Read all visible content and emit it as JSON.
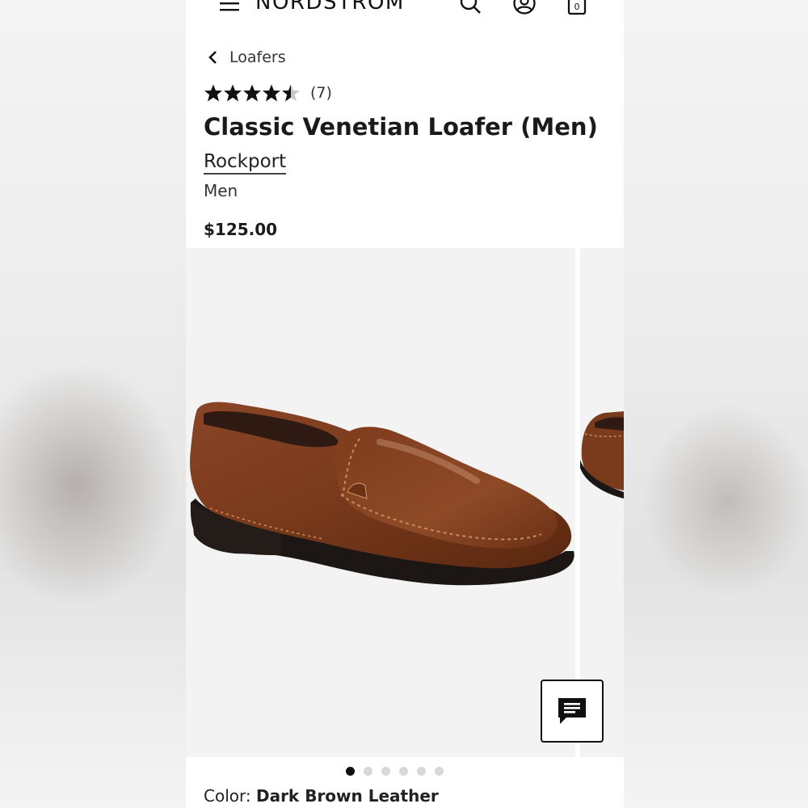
{
  "header": {
    "logo_text": "NORDSTROM",
    "icons": [
      "menu-icon",
      "search-icon",
      "account-icon",
      "bag-icon"
    ],
    "bag_count": "0"
  },
  "breadcrumb": {
    "label": "Loafers"
  },
  "product": {
    "rating": 4.5,
    "rating_max": 5,
    "review_count": "(7)",
    "title": "Classic Venetian Loafer (Men)",
    "brand": "Rockport",
    "category": "Men",
    "price": "$125.00",
    "color_label": "Color:",
    "color_value": "Dark Brown Leather"
  },
  "gallery": {
    "image_count": 6,
    "active_index": 0
  },
  "colors": {
    "text": "#1a1a1a",
    "star": "#111111",
    "star_empty": "#c8c8c8",
    "leather": "#7a3a1c"
  }
}
